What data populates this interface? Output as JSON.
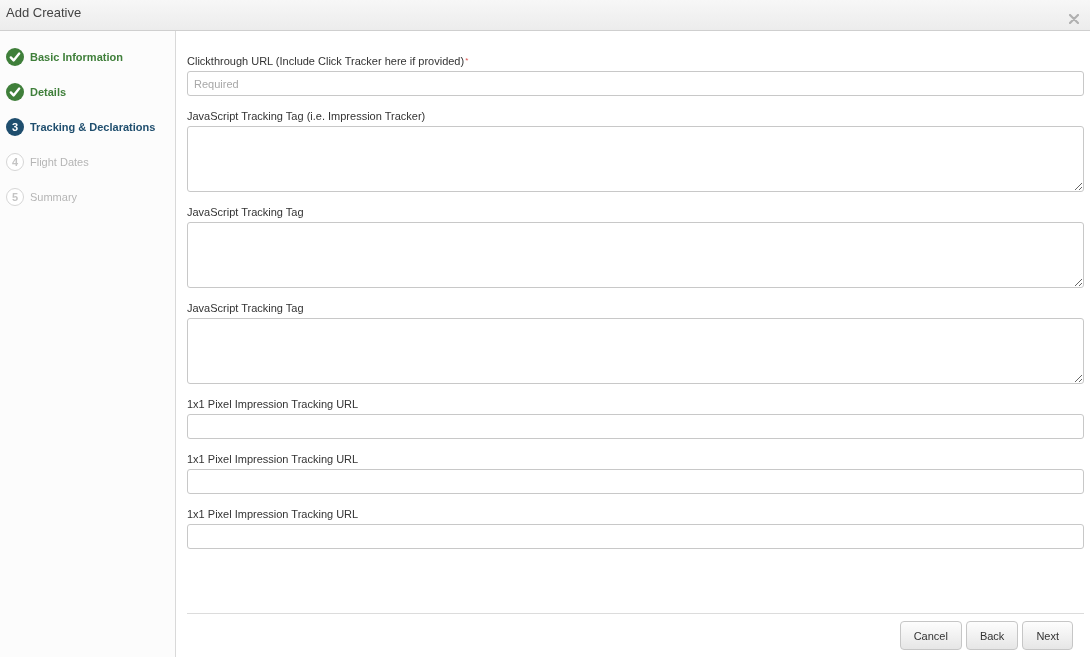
{
  "window": {
    "title": "Add Creative"
  },
  "steps": [
    {
      "label": "Basic Information",
      "completed": true,
      "selected": false
    },
    {
      "label": "Details",
      "completed": true,
      "selected": false
    },
    {
      "label": "Tracking & Declarations",
      "number": "3",
      "completed": false,
      "selected": true
    },
    {
      "label": "Flight Dates",
      "number": "4",
      "completed": false,
      "selected": false
    },
    {
      "label": "Summary",
      "number": "5",
      "completed": false,
      "selected": false
    }
  ],
  "fields": [
    {
      "kind": "input",
      "label": "Clickthrough URL (Include Click Tracker here if provided)",
      "required_mark": "*",
      "placeholder": "Required"
    },
    {
      "kind": "textarea",
      "label": "JavaScript Tracking Tag (i.e. Impression Tracker)"
    },
    {
      "kind": "textarea",
      "label": "JavaScript Tracking Tag"
    },
    {
      "kind": "textarea",
      "label": "JavaScript Tracking Tag"
    },
    {
      "kind": "input",
      "label": "1x1 Pixel Impression Tracking URL"
    },
    {
      "kind": "input",
      "label": "1x1 Pixel Impression Tracking URL"
    },
    {
      "kind": "input",
      "label": "1x1 Pixel Impression Tracking URL"
    }
  ],
  "buttons": [
    "Cancel",
    "Back",
    "Next"
  ]
}
